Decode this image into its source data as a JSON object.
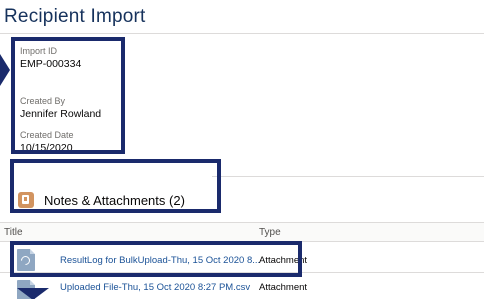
{
  "header": {
    "title": "Recipient Import"
  },
  "fields": {
    "import_id": {
      "label": "Import ID",
      "value": "EMP-000334"
    },
    "created_by": {
      "label": "Created By",
      "value": "Jennifer Rowland"
    },
    "created_date": {
      "label": "Created Date",
      "value": "10/15/2020"
    }
  },
  "notes": {
    "title": "Notes & Attachments (2)",
    "icon": "notes-icon"
  },
  "table": {
    "columns": [
      "Title",
      "Type"
    ],
    "rows": [
      {
        "title": "ResultLog for BulkUpload-Thu, 15 Oct 2020 8...",
        "type": "Attachment",
        "icon": "attachment-file-icon"
      },
      {
        "title": "Uploaded File-Thu, 15 Oct 2020 8:27 PM.csv",
        "type": "Attachment",
        "icon": "file-icon"
      }
    ]
  },
  "colors": {
    "highlight": "#1a2a6c",
    "link": "#1b5297",
    "notes_icon": "#d29460"
  }
}
